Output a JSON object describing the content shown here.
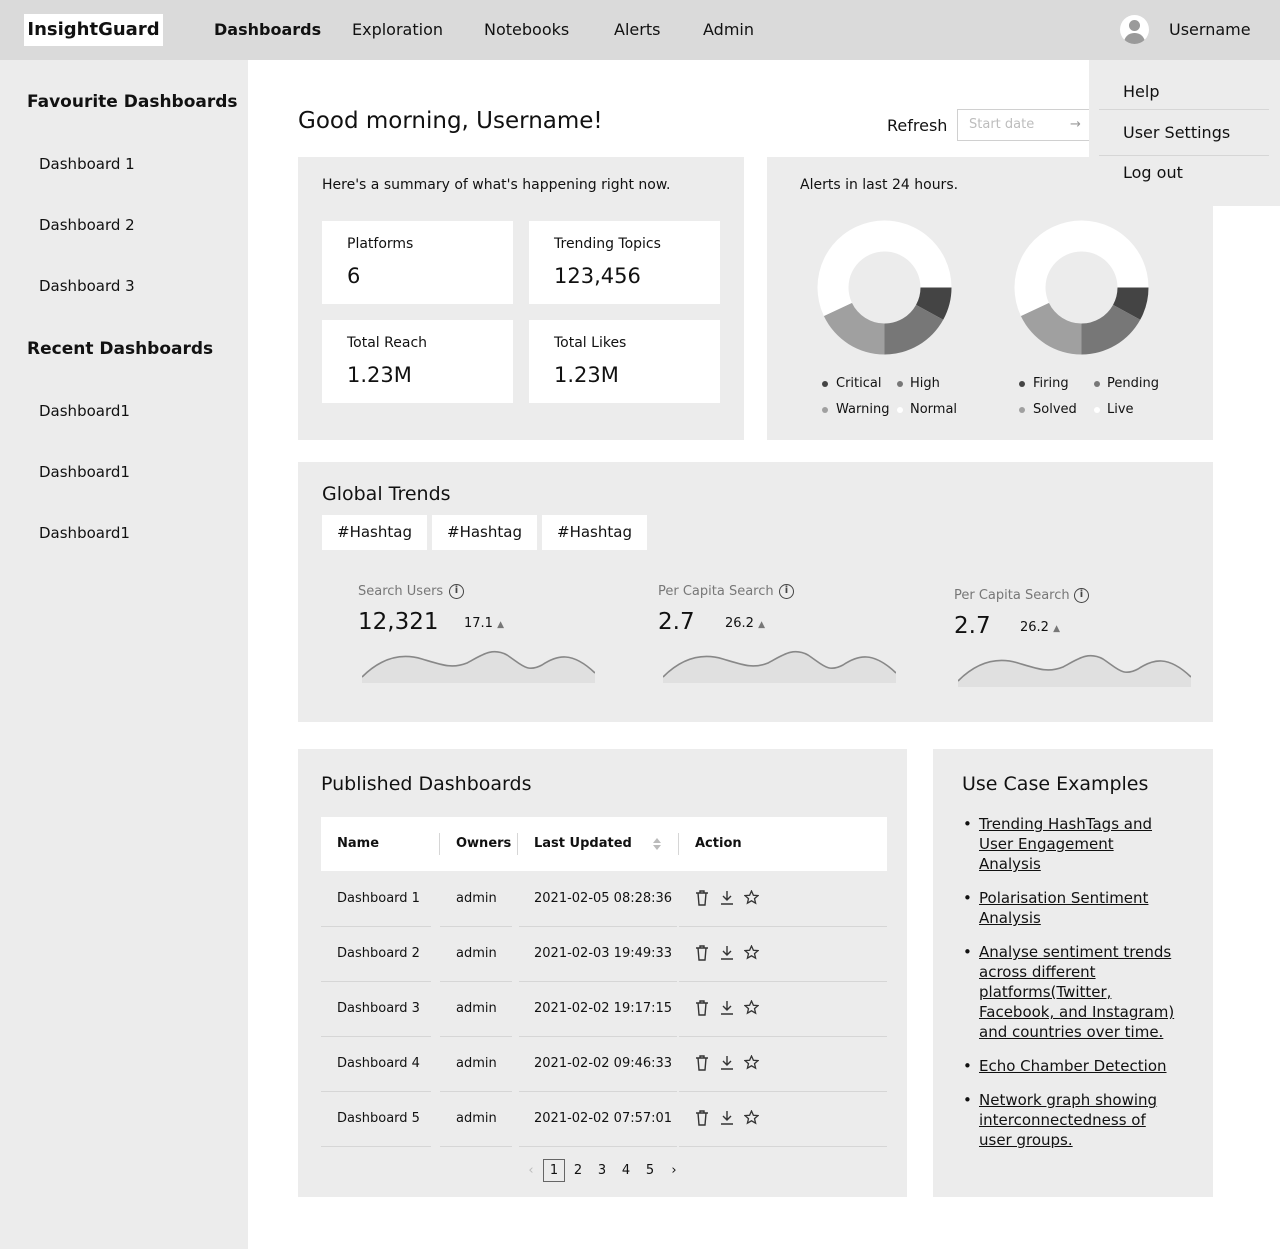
{
  "app": {
    "name": "InsightGuard"
  },
  "nav": {
    "items": [
      "Dashboards",
      "Exploration",
      "Notebooks",
      "Alerts",
      "Admin"
    ],
    "active": "Dashboards"
  },
  "user": {
    "name": "Username"
  },
  "dropdown": {
    "items": [
      "Help",
      "User Settings",
      "Log out"
    ]
  },
  "sidebar": {
    "favourites_title": "Favourite Dashboards",
    "favourites": [
      "Dashboard 1",
      "Dashboard 2",
      "Dashboard 3"
    ],
    "recent_title": "Recent Dashboards",
    "recent": [
      "Dashboard1",
      "Dashboard1",
      "Dashboard1"
    ]
  },
  "header": {
    "greeting": "Good morning, Username!",
    "refresh_label": "Refresh",
    "start_date_placeholder": "Start date",
    "arrow": "→"
  },
  "summary": {
    "label": "Here's a summary of what's happening right now.",
    "cards": [
      {
        "label": "Platforms",
        "value": "6"
      },
      {
        "label": "Trending Topics",
        "value": "123,456"
      },
      {
        "label": "Total Reach",
        "value": "1.23M"
      },
      {
        "label": "Total Likes",
        "value": "1.23M"
      }
    ]
  },
  "alerts": {
    "label": "Alerts in last 24 hours.",
    "donut1_legend": [
      "Critical",
      "High",
      "Warning",
      "Normal"
    ],
    "donut2_legend": [
      "Firing",
      "Pending",
      "Solved",
      "Live"
    ],
    "colors": [
      "#444444",
      "#777777",
      "#a0a0a0",
      "#ffffff"
    ]
  },
  "chart_data": [
    {
      "type": "pie",
      "categories": [
        "Critical",
        "High",
        "Warning",
        "Normal"
      ],
      "values": [
        8,
        17,
        18,
        57
      ]
    },
    {
      "type": "pie",
      "categories": [
        "Firing",
        "Pending",
        "Solved",
        "Live"
      ],
      "values": [
        8,
        17,
        18,
        57
      ]
    }
  ],
  "global_trends": {
    "title": "Global Trends",
    "tags": [
      "#Hashtag",
      "#Hashtag",
      "#Hashtag"
    ],
    "metrics": [
      {
        "label": "Search Users",
        "value": "12,321",
        "delta": "17.1"
      },
      {
        "label": "Per Capita Search",
        "value": "2.7",
        "delta": "26.2"
      },
      {
        "label": "Per Capita Search",
        "value": "2.7",
        "delta": "26.2"
      }
    ]
  },
  "published": {
    "title": "Published Dashboards",
    "columns": [
      "Name",
      "Owners",
      "Last Updated",
      "Action"
    ],
    "rows": [
      {
        "name": "Dashboard 1",
        "owner": "admin",
        "updated": "2021-02-05 08:28:36"
      },
      {
        "name": "Dashboard 2",
        "owner": "admin",
        "updated": "2021-02-03 19:49:33"
      },
      {
        "name": "Dashboard 3",
        "owner": "admin",
        "updated": "2021-02-02 19:17:15"
      },
      {
        "name": "Dashboard 4",
        "owner": "admin",
        "updated": "2021-02-02 09:46:33"
      },
      {
        "name": "Dashboard 5",
        "owner": "admin",
        "updated": "2021-02-02 07:57:01"
      }
    ],
    "pages": [
      "1",
      "2",
      "3",
      "4",
      "5"
    ],
    "current_page": "1"
  },
  "use_cases": {
    "title": "Use Case Examples",
    "items": [
      "Trending HashTags and User Engagement Analysis",
      "Polarisation Sentiment Analysis",
      "Analyse sentiment trends across different platforms(Twitter, Facebook, and Instagram) and countries over time.",
      "Echo Chamber Detection",
      "Network graph showing interconnectedness of user groups."
    ]
  }
}
